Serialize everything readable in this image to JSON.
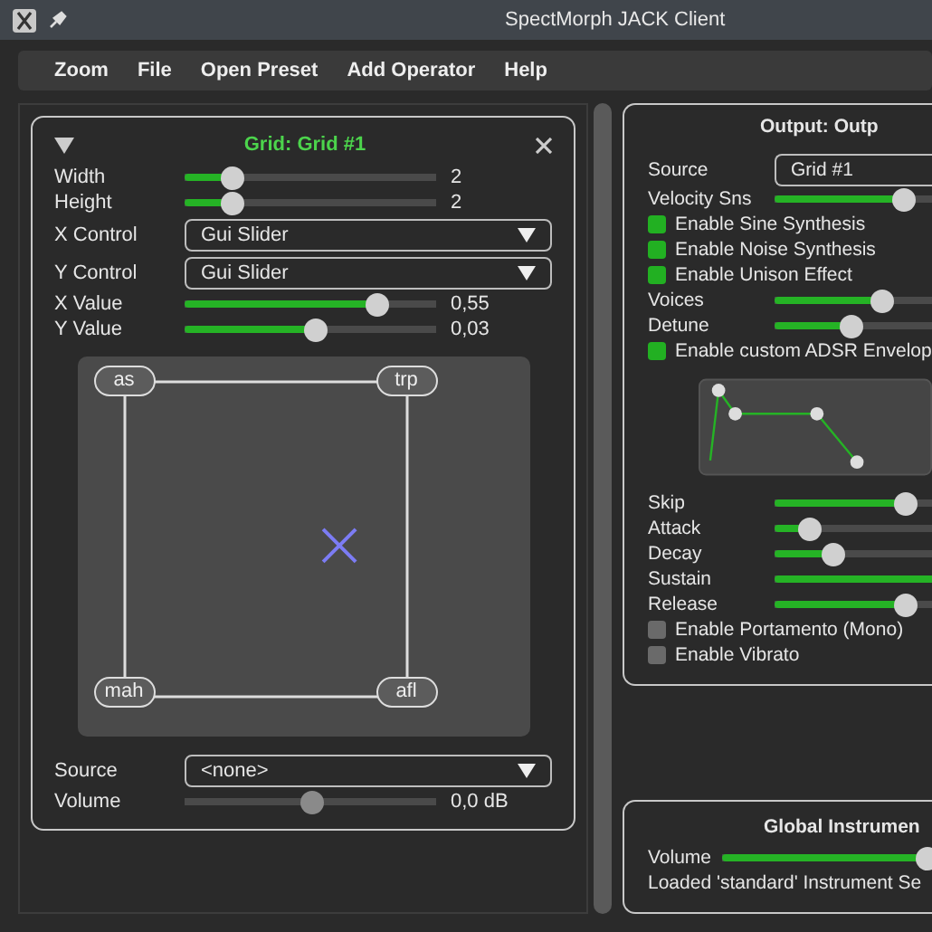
{
  "window": {
    "title": "SpectMorph JACK Client"
  },
  "menu": [
    {
      "label": "Zoom"
    },
    {
      "label": "File"
    },
    {
      "label": "Open Preset"
    },
    {
      "label": "Add Operator"
    },
    {
      "label": "Help"
    }
  ],
  "grid_panel": {
    "title": "Grid: Grid #1",
    "controls": [
      {
        "kind": "slider",
        "label": "Width",
        "level": 0.19,
        "reading": "2",
        "disabled": false
      },
      {
        "kind": "slider",
        "label": "Height",
        "level": 0.19,
        "reading": "2",
        "disabled": false
      },
      {
        "kind": "dropdown",
        "label": "X Control",
        "value": "Gui Slider"
      },
      {
        "kind": "dropdown",
        "label": "Y Control",
        "value": "Gui Slider"
      },
      {
        "kind": "slider",
        "label": "X Value",
        "level": 0.76,
        "reading": "0,55",
        "disabled": false
      },
      {
        "kind": "slider",
        "label": "Y Value",
        "level": 0.52,
        "reading": "0,03",
        "disabled": false
      }
    ],
    "grid_nodes": [
      "as",
      "trp",
      "mah",
      "afl"
    ],
    "footer_controls": [
      {
        "kind": "dropdown",
        "label": "Source",
        "value": "<none>"
      },
      {
        "kind": "slider",
        "label": "Volume",
        "level": 0.5,
        "reading": "0,0 dB",
        "disabled": true
      }
    ]
  },
  "output_panel": {
    "title": "Output: Outp",
    "controls": [
      {
        "kind": "dropdown",
        "label": "Source",
        "value": "Grid #1"
      },
      {
        "kind": "slider",
        "label": "Velocity Sns",
        "level": 0.73
      },
      {
        "kind": "checkbox",
        "label": "Enable Sine Synthesis",
        "checked": true
      },
      {
        "kind": "checkbox",
        "label": "Enable Noise Synthesis",
        "checked": true
      },
      {
        "kind": "checkbox",
        "label": "Enable Unison Effect",
        "checked": true
      },
      {
        "kind": "slider",
        "label": "Voices",
        "level": 0.61
      },
      {
        "kind": "slider",
        "label": "Detune",
        "level": 0.43
      },
      {
        "kind": "checkbox",
        "label": "Enable custom ADSR Envelop",
        "checked": true
      },
      {
        "kind": "envelope"
      },
      {
        "kind": "slider",
        "label": "Skip",
        "level": 0.74
      },
      {
        "kind": "slider",
        "label": "Attack",
        "level": 0.2
      },
      {
        "kind": "slider",
        "label": "Decay",
        "level": 0.33
      },
      {
        "kind": "slider",
        "label": "Sustain",
        "level": 1.0
      },
      {
        "kind": "slider",
        "label": "Release",
        "level": 0.74
      },
      {
        "kind": "checkbox",
        "label": "Enable Portamento (Mono)",
        "checked": false
      },
      {
        "kind": "checkbox",
        "label": "Enable Vibrato",
        "checked": false
      }
    ]
  },
  "global_panel": {
    "title": "Global Instrumen",
    "volume": {
      "label": "Volume",
      "level": 0.9
    },
    "status": "Loaded 'standard' Instrument Se"
  }
}
